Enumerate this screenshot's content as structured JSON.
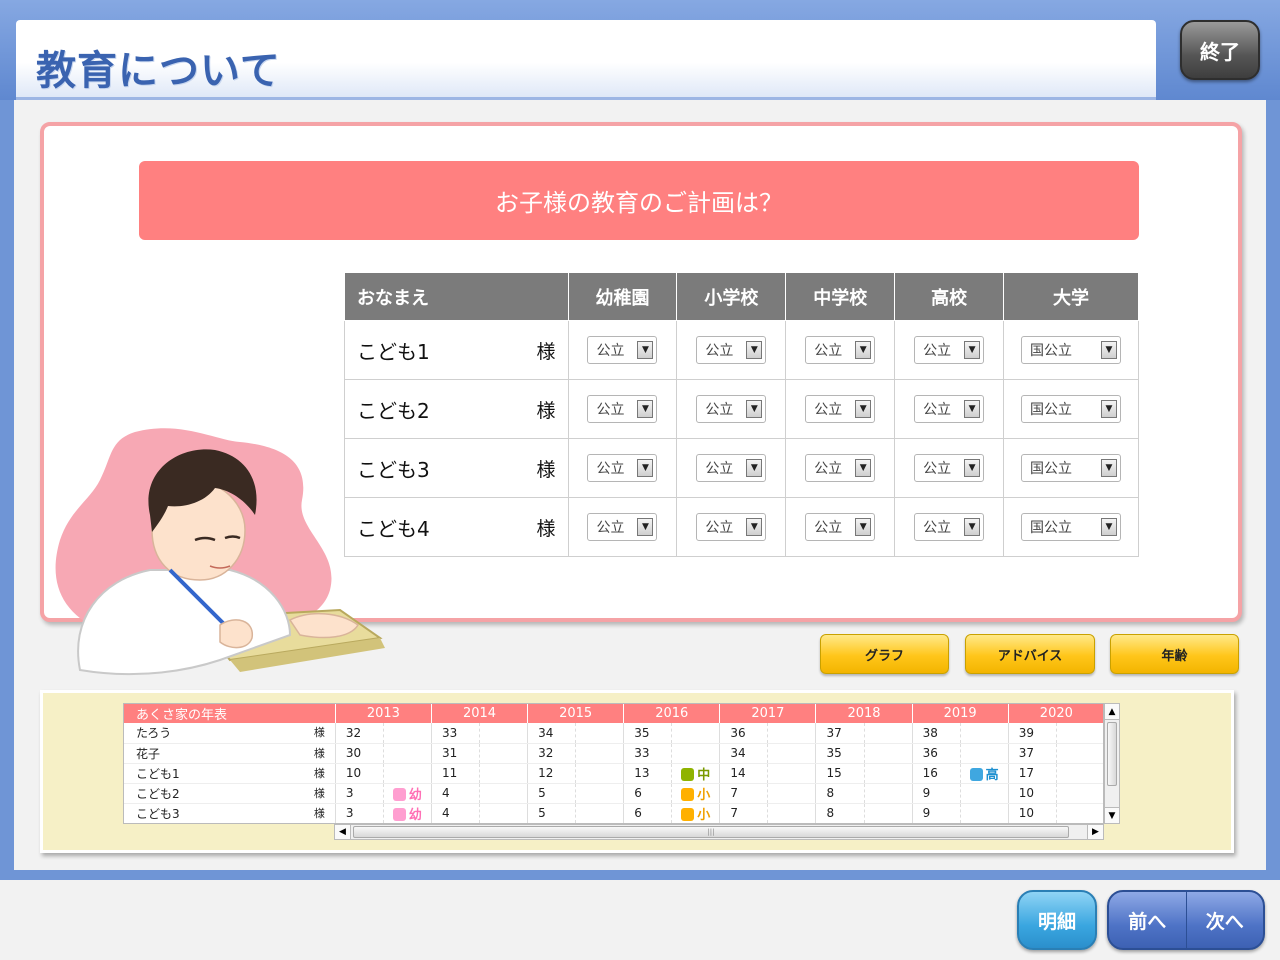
{
  "header": {
    "title": "教育について",
    "end_label": "終了"
  },
  "question": "お子様の教育のご計画は？",
  "education_table": {
    "headers": [
      "おなまえ",
      "幼稚園",
      "小学校",
      "中学校",
      "高校",
      "大学"
    ],
    "name_suffix": "様",
    "rows": [
      {
        "name": "こども1",
        "choices": [
          "公立",
          "公立",
          "公立",
          "公立",
          "国公立"
        ]
      },
      {
        "name": "こども2",
        "choices": [
          "公立",
          "公立",
          "公立",
          "公立",
          "国公立"
        ]
      },
      {
        "name": "こども3",
        "choices": [
          "公立",
          "公立",
          "公立",
          "公立",
          "国公立"
        ]
      },
      {
        "name": "こども4",
        "choices": [
          "公立",
          "公立",
          "公立",
          "公立",
          "国公立"
        ]
      }
    ]
  },
  "buttons": {
    "graph": "グラフ",
    "advice": "アドバイス",
    "age": "年齢"
  },
  "timeline": {
    "title": "あくさ家の年表",
    "suffix": "様",
    "years": [
      "2013",
      "2014",
      "2015",
      "2016",
      "2017",
      "2018",
      "2019",
      "2020"
    ],
    "rows": [
      {
        "name": "たろう",
        "ages": [
          "32",
          "33",
          "34",
          "35",
          "36",
          "37",
          "38",
          "39"
        ],
        "events": [
          "",
          "",
          "",
          "",
          "",
          "",
          "",
          ""
        ]
      },
      {
        "name": "花子",
        "ages": [
          "30",
          "31",
          "32",
          "33",
          "34",
          "35",
          "36",
          "37"
        ],
        "events": [
          "",
          "",
          "",
          "",
          "",
          "",
          "",
          ""
        ]
      },
      {
        "name": "こども1",
        "ages": [
          "10",
          "11",
          "12",
          "13",
          "14",
          "15",
          "16",
          "17"
        ],
        "events": [
          "",
          "",
          "",
          "中",
          "",
          "",
          "高",
          ""
        ]
      },
      {
        "name": "こども2",
        "ages": [
          "3",
          "4",
          "5",
          "6",
          "7",
          "8",
          "9",
          "10"
        ],
        "events": [
          "幼",
          "",
          "",
          "小",
          "",
          "",
          "",
          ""
        ]
      },
      {
        "name": "こども3",
        "ages": [
          "3",
          "4",
          "5",
          "6",
          "7",
          "8",
          "9",
          "10"
        ],
        "events": [
          "幼",
          "",
          "",
          "小",
          "",
          "",
          "",
          ""
        ]
      }
    ]
  },
  "footer": {
    "detail_label": "明細",
    "prev_label": "前へ",
    "next_label": "次へ"
  },
  "colors": {
    "accent_pink": "#ff8080",
    "title_blue": "#3a63b0",
    "button_yellow": "#ffc61a"
  }
}
